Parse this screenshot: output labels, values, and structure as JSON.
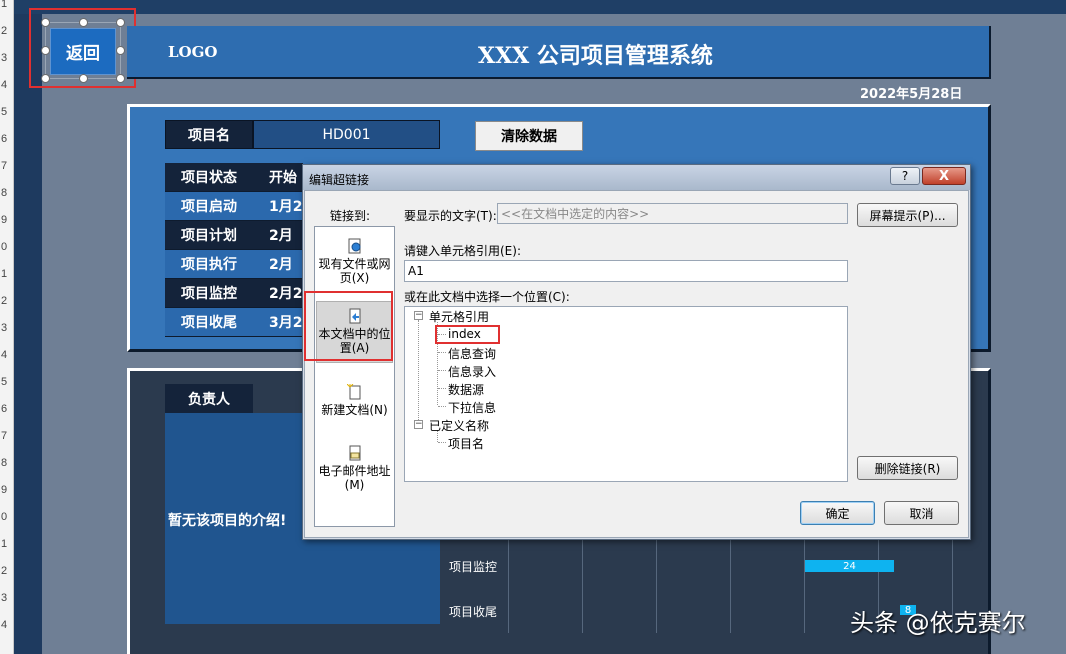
{
  "spreadsheet": {
    "row_numbers": [
      "1",
      "2",
      "3",
      "4",
      "5",
      "6",
      "7",
      "8",
      "9",
      "0",
      "1",
      "2",
      "3",
      "4",
      "5",
      "6",
      "7",
      "8",
      "9",
      "0",
      "1",
      "2",
      "3",
      "4"
    ]
  },
  "back_button": {
    "label": "返回"
  },
  "header": {
    "logo": "LOGO",
    "title": "XXX 公司项目管理系统",
    "date": "2022年5月28日"
  },
  "project": {
    "name_label": "项目名",
    "name_value": "HD001",
    "clear_label": "清除数据"
  },
  "stages": {
    "status_header": "项目状态",
    "start_header": "开始",
    "rows": [
      {
        "label": "项目启动",
        "date": "1月2"
      },
      {
        "label": "项目计划",
        "date": "2月"
      },
      {
        "label": "项目执行",
        "date": "2月"
      },
      {
        "label": "项目监控",
        "date": "2月2"
      },
      {
        "label": "项目收尾",
        "date": "3月2"
      }
    ]
  },
  "owner": {
    "label": "负责人",
    "intro": "暂无该项目的介绍!"
  },
  "gantt": {
    "rows": [
      {
        "label": "项目监控",
        "bar_value": "24"
      },
      {
        "label": "项目收尾",
        "bar_value": "8"
      }
    ]
  },
  "dialog": {
    "title": "编辑超链接",
    "help": "?",
    "close": "X",
    "link_to": "链接到:",
    "nav": [
      {
        "label": "现有文件或网页(X)",
        "icon": "globe-file-icon"
      },
      {
        "label": "本文档中的位置(A)",
        "icon": "document-place-icon"
      },
      {
        "label": "新建文档(N)",
        "icon": "new-document-icon"
      },
      {
        "label": "电子邮件地址(M)",
        "icon": "email-icon"
      }
    ],
    "display_text_label": "要显示的文字(T):",
    "display_text_value": "<<在文档中选定的内容>>",
    "screentip": "屏幕提示(P)...",
    "cell_ref_label": "请键入单元格引用(E):",
    "cell_ref_value": "A1",
    "place_label": "或在此文档中选择一个位置(C):",
    "tree": {
      "group1": "单元格引用",
      "items1": [
        "index",
        "信息查询",
        "信息录入",
        "数据源",
        "下拉信息"
      ],
      "group2": "已定义名称",
      "items2": [
        "项目名"
      ]
    },
    "remove_link": "删除链接(R)",
    "ok": "确定",
    "cancel": "取消"
  },
  "watermark": "头条 @依克赛尔",
  "colors": {
    "header_blue": "#2e6db0",
    "dark_navy": "#14233a",
    "gantt_bar": "#0eb3f0",
    "highlight_red": "#e03030"
  }
}
